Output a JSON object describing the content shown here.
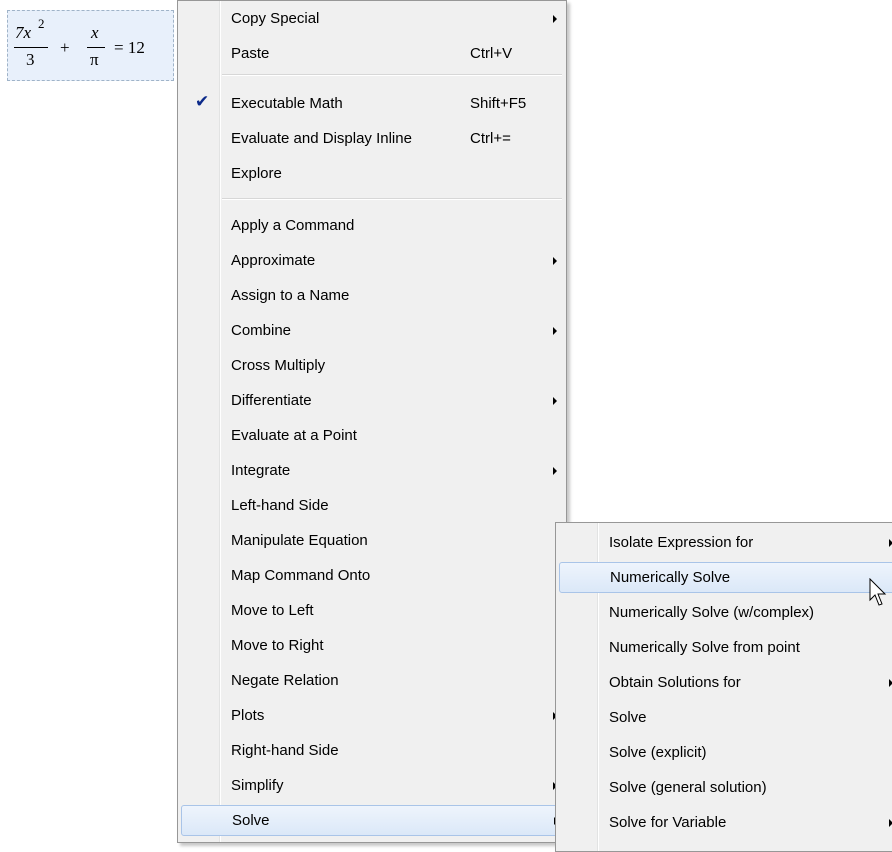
{
  "expression": {
    "num1": "7x",
    "exp": "2",
    "den1": "3",
    "plus": "+",
    "num2": "x",
    "den2": "π",
    "rhs": "= 12"
  },
  "context_menu": {
    "items": [
      {
        "label": "Copy Special",
        "accel": "",
        "submenu": true
      },
      {
        "label": "Paste",
        "accel": "Ctrl+V",
        "submenu": false
      },
      {
        "label": "Executable Math",
        "accel": "Shift+F5",
        "submenu": false,
        "checked": true
      },
      {
        "label": "Evaluate and Display Inline",
        "accel": "Ctrl+=",
        "submenu": false
      },
      {
        "label": "Explore",
        "accel": "",
        "submenu": false
      },
      {
        "label": "Apply a Command",
        "accel": "",
        "submenu": false
      },
      {
        "label": "Approximate",
        "accel": "",
        "submenu": true
      },
      {
        "label": "Assign to a Name",
        "accel": "",
        "submenu": false
      },
      {
        "label": "Combine",
        "accel": "",
        "submenu": true
      },
      {
        "label": "Cross Multiply",
        "accel": "",
        "submenu": false
      },
      {
        "label": "Differentiate",
        "accel": "",
        "submenu": true
      },
      {
        "label": "Evaluate at a Point",
        "accel": "",
        "submenu": false
      },
      {
        "label": "Integrate",
        "accel": "",
        "submenu": true
      },
      {
        "label": "Left-hand Side",
        "accel": "",
        "submenu": false
      },
      {
        "label": "Manipulate Equation",
        "accel": "",
        "submenu": false
      },
      {
        "label": "Map Command Onto",
        "accel": "",
        "submenu": false
      },
      {
        "label": "Move to Left",
        "accel": "",
        "submenu": false
      },
      {
        "label": "Move to Right",
        "accel": "",
        "submenu": false
      },
      {
        "label": "Negate Relation",
        "accel": "",
        "submenu": false
      },
      {
        "label": "Plots",
        "accel": "",
        "submenu": true
      },
      {
        "label": "Right-hand Side",
        "accel": "",
        "submenu": false
      },
      {
        "label": "Simplify",
        "accel": "",
        "submenu": true
      },
      {
        "label": "Solve",
        "accel": "",
        "submenu": true,
        "highlighted": true
      }
    ]
  },
  "solve_submenu": {
    "items": [
      {
        "label": "Isolate Expression for",
        "submenu": true
      },
      {
        "label": "Numerically Solve",
        "submenu": false,
        "highlighted": true
      },
      {
        "label": "Numerically Solve (w/complex)",
        "submenu": false
      },
      {
        "label": "Numerically Solve from point",
        "submenu": false
      },
      {
        "label": "Obtain Solutions for",
        "submenu": true
      },
      {
        "label": "Solve",
        "submenu": false
      },
      {
        "label": "Solve (explicit)",
        "submenu": false
      },
      {
        "label": "Solve (general solution)",
        "submenu": false
      },
      {
        "label": "Solve for Variable",
        "submenu": true
      }
    ]
  },
  "icons": {
    "check": "checkmark-icon",
    "pointer": "mouse-pointer-icon"
  },
  "colors": {
    "menu_bg": "#f0f0f0",
    "highlight_border": "#a9c4e8",
    "check": "#0c2a8a",
    "math_box_bg": "#e8f0fb"
  }
}
